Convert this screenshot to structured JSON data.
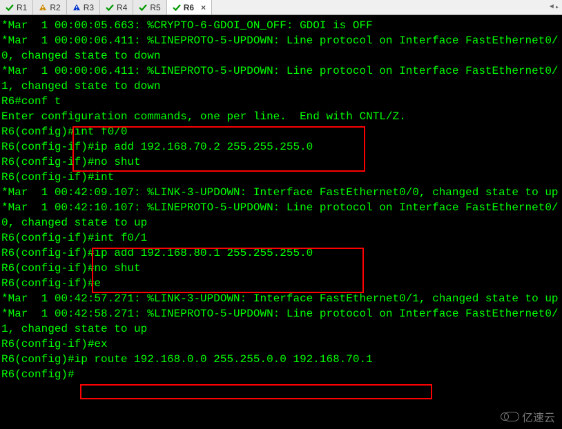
{
  "tabs": [
    {
      "label": "R1",
      "icon": "check",
      "color": "#009900"
    },
    {
      "label": "R2",
      "icon": "warn",
      "color": "#cc8800"
    },
    {
      "label": "R3",
      "icon": "warn",
      "color": "#0033cc"
    },
    {
      "label": "R4",
      "icon": "check",
      "color": "#009900"
    },
    {
      "label": "R5",
      "icon": "check",
      "color": "#009900"
    },
    {
      "label": "R6",
      "icon": "check",
      "color": "#009900",
      "active": true,
      "closable": true
    }
  ],
  "terminal_lines": [
    "*Mar  1 00:00:05.663: %CRYPTO-6-GDOI_ON_OFF: GDOI is OFF",
    "*Mar  1 00:00:06.411: %LINEPROTO-5-UPDOWN: Line protocol on Interface FastEthernet0/0, changed state to down",
    "*Mar  1 00:00:06.411: %LINEPROTO-5-UPDOWN: Line protocol on Interface FastEthernet0/1, changed state to down",
    "R6#conf t",
    "Enter configuration commands, one per line.  End with CNTL/Z.",
    "R6(config)#int f0/0",
    "R6(config-if)#ip add 192.168.70.2 255.255.255.0",
    "R6(config-if)#no shut",
    "R6(config-if)#int",
    "*Mar  1 00:42:09.107: %LINK-3-UPDOWN: Interface FastEthernet0/0, changed state to up",
    "*Mar  1 00:42:10.107: %LINEPROTO-5-UPDOWN: Line protocol on Interface FastEthernet0/0, changed state to up",
    "R6(config-if)#int f0/1",
    "R6(config-if)#ip add 192.168.80.1 255.255.255.0",
    "R6(config-if)#no shut",
    "R6(config-if)#e",
    "*Mar  1 00:42:57.271: %LINK-3-UPDOWN: Interface FastEthernet0/1, changed state to up",
    "*Mar  1 00:42:58.271: %LINEPROTO-5-UPDOWN: Line protocol on Interface FastEthernet0/1, changed state to up",
    "R6(config-if)#ex",
    "R6(config)#ip route 192.168.0.0 255.255.0.0 192.168.70.1",
    "R6(config)#"
  ],
  "highlights": [
    {
      "name": "int-f0-0-block",
      "cmds": [
        "int f0/0",
        "ip add 192.168.70.2 255.255.255.0",
        "no shut"
      ]
    },
    {
      "name": "int-f0-1-block",
      "cmds": [
        "int f0/1",
        "ip add 192.168.80.1 255.255.255.0",
        "no shut"
      ]
    },
    {
      "name": "ip-route-block",
      "cmds": [
        "ip route 192.168.0.0 255.255.0.0 192.168.70.1"
      ]
    }
  ],
  "watermark": "亿速云"
}
